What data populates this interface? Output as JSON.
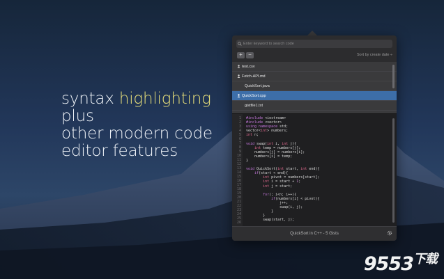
{
  "tagline": {
    "line1_prefix": "syntax ",
    "line1_highlight": "highlighting",
    "line2": "plus",
    "line3": "other modern code",
    "line4": "editor features"
  },
  "window": {
    "search": {
      "placeholder": "Enter keyword to search code",
      "value": ""
    },
    "toolbar": {
      "add_label": "+",
      "remove_label": "−",
      "sort_label": "Sort by create date ÷"
    },
    "files": [
      {
        "name": "test.csv",
        "shared": true,
        "selected": false
      },
      {
        "name": "Fetch-API.md",
        "shared": true,
        "selected": false
      },
      {
        "name": "QuickSort.java",
        "shared": false,
        "selected": false
      },
      {
        "name": "QuickSort.cpp",
        "shared": true,
        "selected": true
      },
      {
        "name": "gistfile1.txt",
        "shared": false,
        "selected": false
      }
    ],
    "status": "QuickSort in C++ - 5 Gists"
  },
  "colors": {
    "accent": "#3d6ea8",
    "highlight": "#e8df7a"
  },
  "watermark": {
    "brand": "9553",
    "suffix": "下载"
  }
}
